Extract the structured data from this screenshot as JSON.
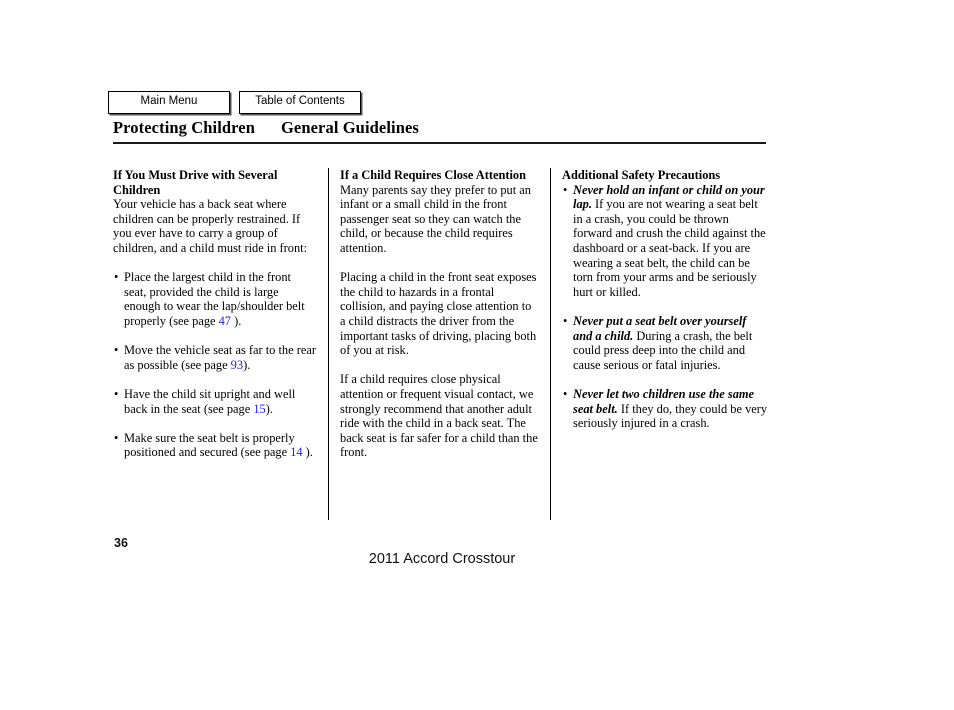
{
  "nav": {
    "main_menu_label": "Main Menu",
    "table_of_contents_label": "Table of Contents"
  },
  "header": {
    "section": "Protecting Children",
    "subsection": "General Guidelines"
  },
  "columns": {
    "col1": {
      "heading": "If You Must Drive with Several Children",
      "intro": "Your vehicle has a back seat where children can be properly restrained. If you ever have to carry a group of children, and a child must ride in front:",
      "bullets": [
        {
          "text_before": "Place the largest child in the front seat, provided the child is large enough to wear the lap/shoulder belt properly (see page ",
          "page_link": "47",
          "text_after": " )."
        },
        {
          "text_before": "Move the vehicle seat as far to the rear as possible (see page ",
          "page_link": "93",
          "text_after": ")."
        },
        {
          "text_before": "Have the child sit upright and well back in the seat (see page ",
          "page_link": "15",
          "text_after": ")."
        },
        {
          "text_before": "Make sure the seat belt is properly positioned and secured (see page ",
          "page_link": "14",
          "text_after": " )."
        }
      ]
    },
    "col2": {
      "heading": "If a Child Requires Close Attention",
      "para1": "Many parents say they prefer to put an infant or a small child in the front passenger seat so they can watch the child, or because the child requires attention.",
      "para2": "Placing a child in the front seat exposes the child to hazards in a frontal collision, and paying close attention to a child distracts the driver from the important tasks of driving, placing both of you at risk.",
      "para3": "If a child requires close physical attention or frequent visual contact, we strongly recommend that another adult ride with the child in a back seat. The back seat is far safer for a child than the front."
    },
    "col3": {
      "heading": "Additional Safety Precautions",
      "bullets": [
        {
          "lead": "Never hold an infant or child on your lap.",
          "body": " If you are not wearing a seat belt in a crash, you could be thrown forward and crush the child against the dashboard or a seat-back. If you are wearing a seat belt, the child can be torn from your arms and be seriously hurt or killed."
        },
        {
          "lead": "Never put a seat belt over yourself and a child.",
          "body": " During a crash, the belt could press deep into the child and cause serious or fatal injuries."
        },
        {
          "lead": "Never let two children use the same seat belt.",
          "body": " If they do, they could be very seriously injured in a crash."
        }
      ]
    }
  },
  "footer": {
    "page_number": "36",
    "model": "2011 Accord Crosstour"
  },
  "bullet_glyph": "•",
  "colors": {
    "link": "#2222dd",
    "text": "#000000",
    "rule": "#1a1a1a"
  }
}
